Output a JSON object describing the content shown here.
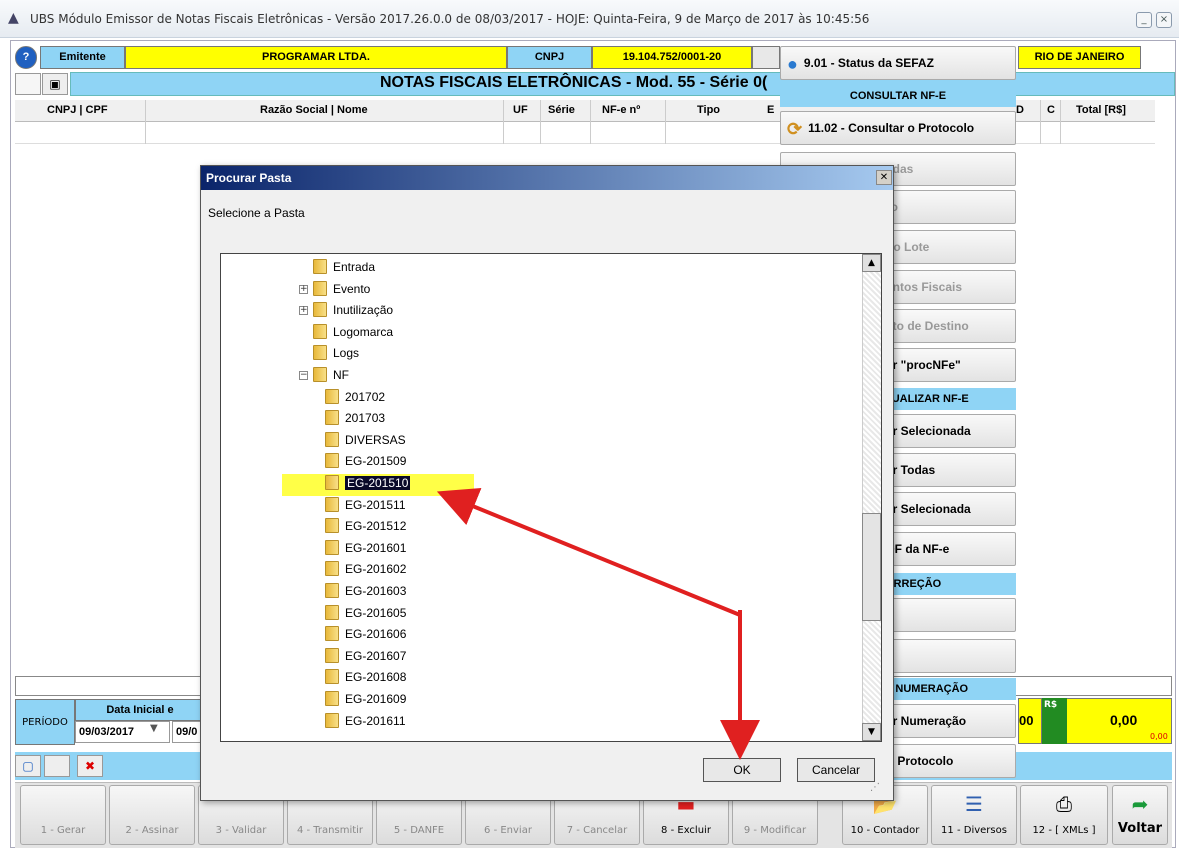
{
  "window": {
    "title": "UBS Módulo Emissor de Notas Fiscais Eletrônicas - Versão 2017.26.0.0 de 08/03/2017 - HOJE: Quinta-Feira,  9 de Março de 2017 às 10:45:56",
    "minimize": "_",
    "close": "×"
  },
  "header": {
    "help": "?",
    "emitente_label": "Emitente",
    "emitente_value": "PROGRAMAR LTDA.",
    "cnpj_label": "CNPJ",
    "cnpj_value": "19.104.752/0001-20",
    "cidade": "RIO DE JANEIRO"
  },
  "banner": {
    "title": "NOTAS FISCAIS ELETRÔNICAS - Mod. 55 - Série 0("
  },
  "grid": {
    "columns": [
      "CNPJ | CPF",
      "Razão Social | Nome",
      "UF",
      "Série",
      "NF-e nº",
      "Tipo",
      "E",
      "D",
      "C",
      "Total [R$]"
    ]
  },
  "right_panel": {
    "status_sefaz": "9.01 - Status da SEFAZ",
    "consultar_header": "CONSULTAR NF-E",
    "consultar_protocolo": "11.02 - Consultar o Protocolo",
    "items": [
      "adas",
      "ro",
      "do Lote",
      "entos Fiscais",
      "sto de Destino",
      "ar \"procNFe\""
    ],
    "atualizar_header": "TUALIZAR NF-E",
    "items2": [
      "ar Selecionada",
      "ar Todas",
      "ar Selecionada",
      "DF da NF-e"
    ],
    "correcao_header": "ORREÇÃO",
    "items3": [
      "",
      "ir"
    ],
    "numeracao_header": "E NUMERAÇÃO",
    "items4": [
      "ar Numeração",
      "ir Protocolo"
    ]
  },
  "periodo": {
    "label": "PERÍODO",
    "data_inicial": "Data Inicial e",
    "date1": "09/03/2017",
    "date2": "09/0"
  },
  "totals": {
    "left_fragment": "00",
    "currency": "R$",
    "value": "0,00",
    "sub": "0,00"
  },
  "bottom_buttons": [
    "1 - Gerar",
    "2 - Assinar",
    "3 - Validar",
    "4 - Transmitir",
    "5 - DANFE",
    "6 - Enviar",
    "7 - Cancelar",
    "8 - Excluir",
    "9 - Modificar",
    "10 - Contador",
    "11 - Diversos",
    "12 - [ XMLs ]",
    "Voltar"
  ],
  "dialog": {
    "title": "Procurar Pasta",
    "prompt": "Selecione a Pasta",
    "ok": "OK",
    "cancel": "Cancelar",
    "tree": [
      {
        "label": "Entrada",
        "expander": ""
      },
      {
        "label": "Evento",
        "expander": "+"
      },
      {
        "label": "Inutilização",
        "expander": "+"
      },
      {
        "label": "Logomarca",
        "expander": ""
      },
      {
        "label": "Logs",
        "expander": ""
      },
      {
        "label": "NF",
        "expander": "−"
      },
      {
        "label": "201702",
        "expander": ""
      },
      {
        "label": "201703",
        "expander": ""
      },
      {
        "label": "DIVERSAS",
        "expander": ""
      },
      {
        "label": "EG-201509",
        "expander": ""
      },
      {
        "label": "EG-201510",
        "expander": "",
        "selected": true
      },
      {
        "label": "EG-201511",
        "expander": ""
      },
      {
        "label": "EG-201512",
        "expander": ""
      },
      {
        "label": "EG-201601",
        "expander": ""
      },
      {
        "label": "EG-201602",
        "expander": ""
      },
      {
        "label": "EG-201603",
        "expander": ""
      },
      {
        "label": "EG-201605",
        "expander": ""
      },
      {
        "label": "EG-201606",
        "expander": ""
      },
      {
        "label": "EG-201607",
        "expander": ""
      },
      {
        "label": "EG-201608",
        "expander": ""
      },
      {
        "label": "EG-201609",
        "expander": ""
      },
      {
        "label": "EG-201611",
        "expander": ""
      }
    ]
  },
  "colors": {
    "accent_blue": "#8fd4f5",
    "field_yellow": "#ffff00",
    "annotation_red": "#e02020",
    "highlight_yellow": "#ffff33"
  }
}
